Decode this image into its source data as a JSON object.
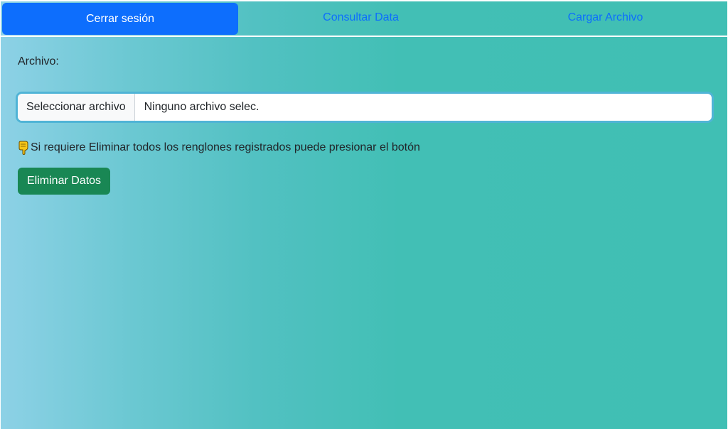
{
  "nav": {
    "items": [
      {
        "label": "Cerrar sesión",
        "active": true
      },
      {
        "label": "Consultar Data",
        "active": false
      },
      {
        "label": "Cargar Archivo",
        "active": false
      }
    ]
  },
  "form": {
    "file_label": "Archivo:",
    "file_button_label": "Seleccionar archivo",
    "file_name_value": "Ninguno archivo selec.",
    "hint_icon": "pointing-down-hand-icon",
    "hint_text": "Si requiere Eliminar todos los renglones registrados puede presionar el botón",
    "delete_button_label": "Eliminar Datos"
  },
  "colors": {
    "primary": "#0d6efd",
    "success": "#198754",
    "gradient_start": "#8dd1e6",
    "gradient_end": "#40bfb4",
    "focus_ring": "#50b4d6"
  }
}
